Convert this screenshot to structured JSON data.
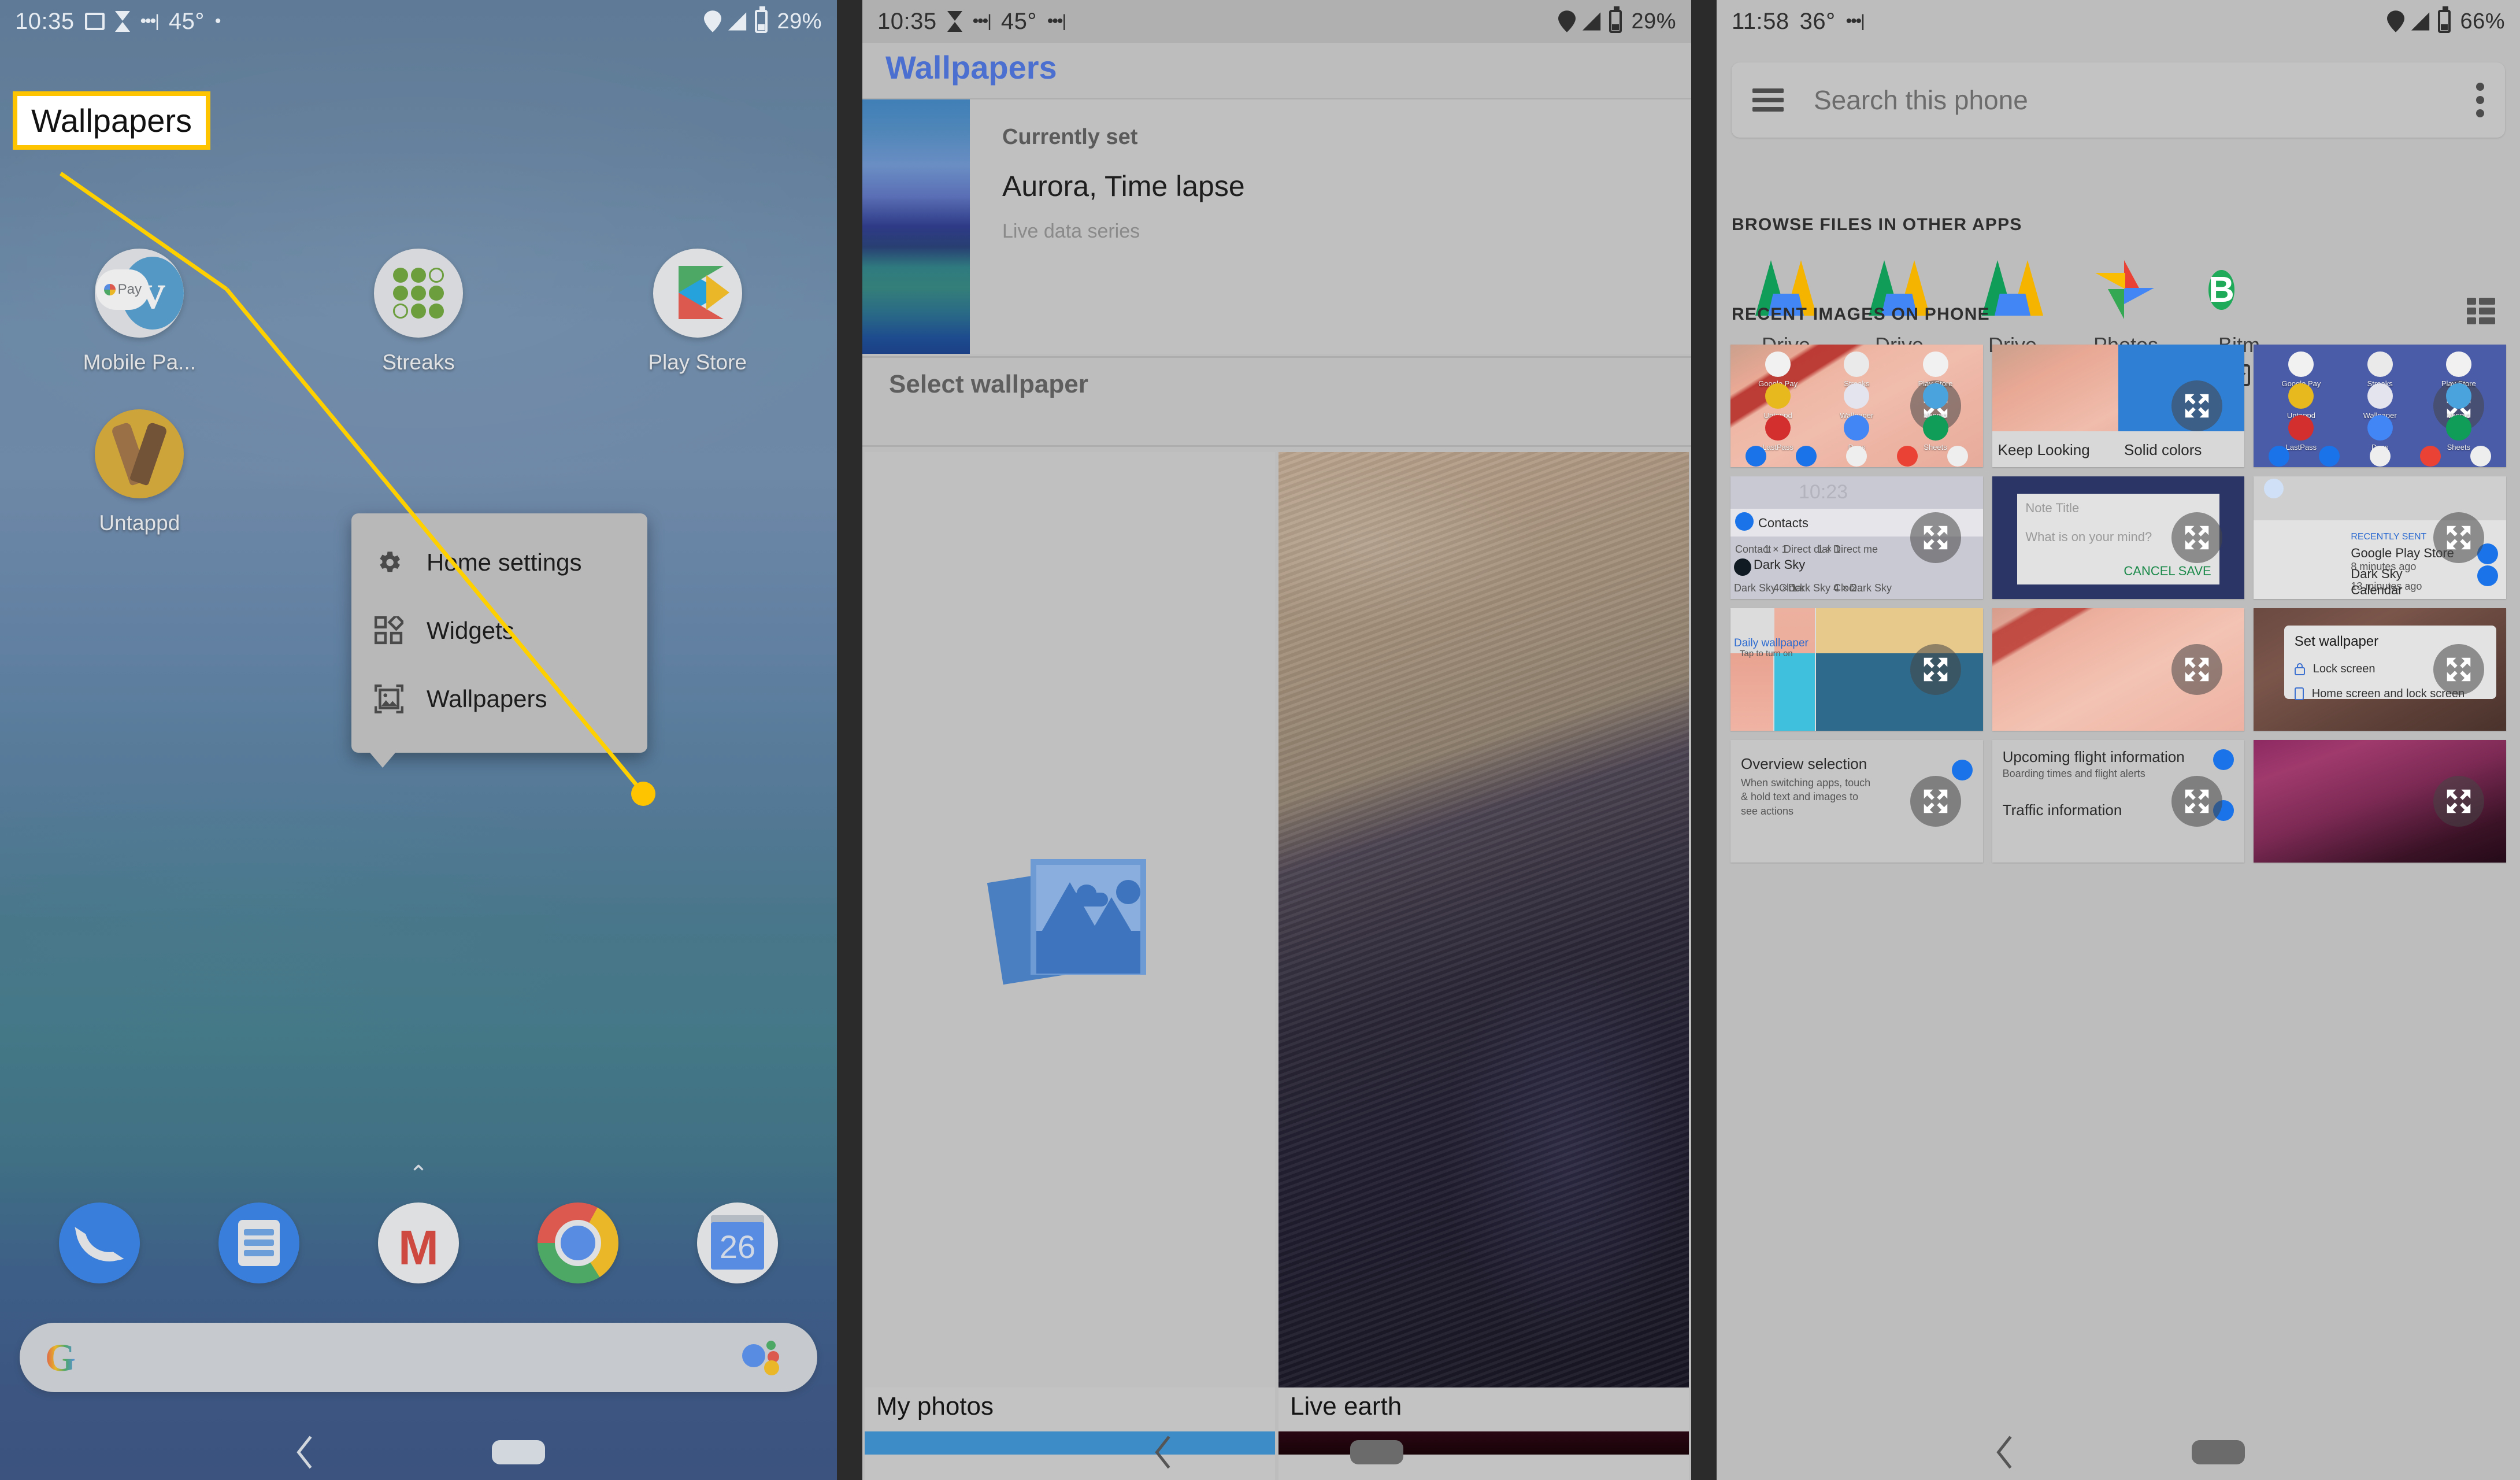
{
  "panel1": {
    "status": {
      "time": "10:35",
      "temp": "45°",
      "battery": "29%",
      "icons": [
        "image-icon",
        "hourglass-icon",
        "dots-icon",
        "dot-icon",
        "location-icon",
        "signal-icon",
        "battery-icon"
      ]
    },
    "callout": {
      "text": "Wallpapers"
    },
    "apps": [
      {
        "label": "Mobile Pa...",
        "icon": "venmo-gpay-icon"
      },
      {
        "label": "Streaks",
        "icon": "streaks-icon"
      },
      {
        "label": "Play Store",
        "icon": "play-store-icon"
      },
      {
        "label": "Untappd",
        "icon": "untappd-icon"
      }
    ],
    "page_arrow": "⌃",
    "dock": [
      {
        "label": "Phone",
        "icon": "phone-icon"
      },
      {
        "label": "Messages",
        "icon": "messages-icon"
      },
      {
        "label": "Gmail",
        "icon": "gmail-icon"
      },
      {
        "label": "Chrome",
        "icon": "chrome-icon"
      },
      {
        "label": "Calendar",
        "icon": "calendar-icon",
        "day": "26"
      }
    ],
    "search": {
      "logo": "G",
      "assistant": "google-assistant-icon"
    },
    "popup": {
      "items": [
        {
          "label": "Home settings",
          "icon": "gear-icon"
        },
        {
          "label": "Widgets",
          "icon": "widgets-icon"
        },
        {
          "label": "Wallpapers",
          "icon": "wallpaper-icon"
        }
      ]
    },
    "nav": {
      "back": "back-icon",
      "home": "home-pill-icon"
    }
  },
  "panel2": {
    "status": {
      "time": "10:35",
      "temp": "45°",
      "battery": "29%"
    },
    "title": "Wallpapers",
    "current": {
      "label": "Currently set",
      "name": "Aurora, Time lapse",
      "sub": "Live data series"
    },
    "select_header": "Select wallpaper",
    "cards": [
      {
        "caption": "My photos",
        "art": "photo-placeholder-icon",
        "strip": "blue"
      },
      {
        "caption": "Live earth",
        "art": "rocky-terrain-image",
        "strip": "dark"
      }
    ],
    "nav": {
      "back": "back-icon",
      "home": "home-pill-icon"
    }
  },
  "panel3": {
    "status": {
      "time": "11:58",
      "temp": "36°",
      "battery": "66%"
    },
    "search": {
      "placeholder": "Search this phone",
      "menu_icon": "hamburger-icon",
      "overflow_icon": "kebab-icon"
    },
    "sections": {
      "browse": "BROWSE FILES IN OTHER APPS",
      "recent": "RECENT IMAGES ON PHONE"
    },
    "apps": [
      {
        "label": "Drive",
        "icon": "google-drive-icon",
        "badge": false
      },
      {
        "label": "Drive",
        "icon": "google-drive-icon",
        "badge": false
      },
      {
        "label": "Drive",
        "icon": "google-drive-icon",
        "badge": false
      },
      {
        "label": "Photos",
        "icon": "google-photos-icon",
        "badge": true
      },
      {
        "label": "Bitm",
        "icon": "bitmoji-icon",
        "badge": true
      }
    ],
    "view_toggle_icon": "list-view-icon",
    "thumbnails": [
      {
        "kind": "home-screen",
        "labels": [
          "Google Pay",
          "Streaks",
          "Play Store",
          "Untappd",
          "Wallpaper",
          "Venmo",
          "LastPass",
          "Docs",
          "Sheets"
        ]
      },
      {
        "kind": "wallpaper-pick",
        "captions": [
          "Keep Looking",
          "Solid colors"
        ]
      },
      {
        "kind": "home-screen-blue",
        "labels": [
          "Google Pay",
          "Streaks",
          "Play Store",
          "Untappd",
          "Wallpaper",
          "Venmo",
          "LastPass",
          "Docs",
          "Sheets"
        ]
      },
      {
        "kind": "widget-picker",
        "labels": [
          "Contacts",
          "Contact",
          "1 × 1",
          "Direct dial",
          "1 × 1",
          "Direct me",
          "Dark Sky",
          "Dark Sky Clock",
          "4 × 1",
          "Dark Sky Cloc...",
          "4 × 2",
          "Dark Sky"
        ],
        "clock": "10:23"
      },
      {
        "kind": "note-dialog",
        "title": "Note Title",
        "body": "What is on your mind?",
        "cancel": "CANCEL",
        "save": "SAVE"
      },
      {
        "kind": "notifications",
        "section": "RECENTLY SENT",
        "rows": [
          {
            "name": "Google Play Store",
            "time": "8 minutes ago"
          },
          {
            "name": "Dark Sky",
            "time": "13 minutes ago"
          },
          {
            "name": "Calendar",
            "time": ""
          }
        ]
      },
      {
        "kind": "daily-wallpaper",
        "label": "Daily wallpaper",
        "sub": "Tap to turn on"
      },
      {
        "kind": "pink-sheet"
      },
      {
        "kind": "set-wallpaper-dialog",
        "title": "Set wallpaper",
        "options": [
          {
            "label": "Lock screen",
            "icon": "lock-icon"
          },
          {
            "label": "Home screen and lock screen",
            "icon": "phone-outline-icon"
          }
        ]
      },
      {
        "kind": "overview-setting",
        "title": "Overview selection",
        "sub": "When switching apps, touch & hold text and images to see actions"
      },
      {
        "kind": "flight-setting",
        "title": "Upcoming flight information",
        "sub": "Boarding times and flight alerts",
        "title2": "Traffic information"
      },
      {
        "kind": "purple-rock"
      }
    ],
    "expand_icon": "expand-icon",
    "nav": {
      "back": "back-icon",
      "home": "home-pill-icon"
    }
  },
  "colors": {
    "accent_blue": "#4a6fd0",
    "callout_yellow": "#ffc400",
    "panel_gray": "#bdbdbd",
    "toggle_blue": "#1a73e8"
  }
}
